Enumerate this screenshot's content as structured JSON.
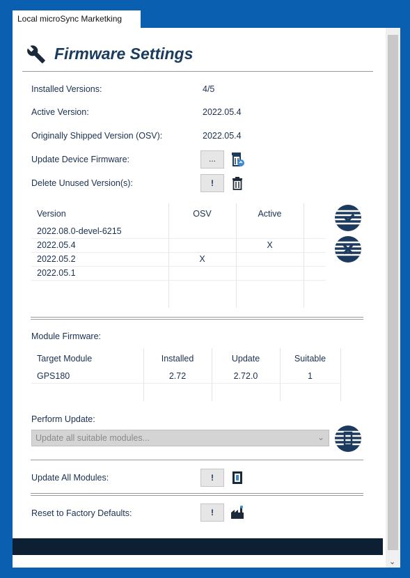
{
  "window": {
    "tab_label": "Local microSync Marketking"
  },
  "header": {
    "title": "Firmware Settings",
    "icon": "wrench-icon"
  },
  "info": {
    "installed_label": "Installed Versions:",
    "installed_value": "4/5",
    "active_label": "Active Version:",
    "active_value": "2022.05.4",
    "osv_label": "Originally Shipped Version (OSV):",
    "osv_value": "2022.05.4",
    "update_label": "Update Device Firmware:",
    "update_btn": "...",
    "delete_label": "Delete Unused Version(s):",
    "delete_btn": "!"
  },
  "versions": {
    "headers": [
      "Version",
      "OSV",
      "Active"
    ],
    "rows": [
      [
        "2022.08.0-devel-6215",
        "",
        ""
      ],
      [
        "2022.05.4",
        "",
        "X"
      ],
      [
        "2022.05.2",
        "X",
        ""
      ],
      [
        "2022.05.1",
        "",
        ""
      ]
    ]
  },
  "modules": {
    "label": "Module Firmware:",
    "headers": [
      "Target Module",
      "Installed",
      "Update",
      "Suitable"
    ],
    "rows": [
      [
        "GPS180",
        "2.72",
        "2.72.0",
        "1"
      ]
    ]
  },
  "perform": {
    "label": "Perform Update:",
    "select_value": "Update all suitable modules..."
  },
  "update_all": {
    "label": "Update All Modules:",
    "btn": "!"
  },
  "reset": {
    "label": "Reset to Factory Defaults:",
    "btn": "!"
  },
  "colors": {
    "background": "#0a5fb0",
    "accent": "#1a3a5e",
    "footer": "#0d1f33"
  }
}
